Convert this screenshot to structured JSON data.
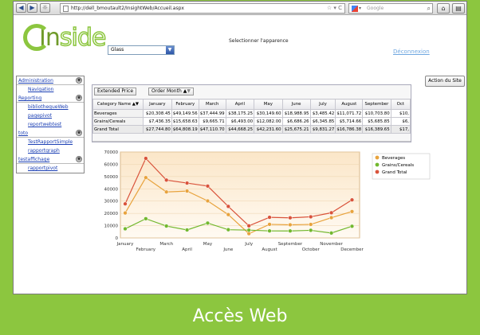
{
  "browser": {
    "url": "http://dell_bmoutault2/InsightWeb/Accueil.aspx",
    "search_placeholder": "Google"
  },
  "header": {
    "logo_in": "In",
    "logo_side": "side",
    "theme_value": "Glass",
    "theme_label": "Selectionner l'apparence",
    "logout": "Déconnexion"
  },
  "sidebar": {
    "groups": [
      {
        "label": "Administration",
        "items": [
          "Navigation"
        ]
      },
      {
        "label": "Reporting",
        "items": [
          "bibliothequeWeb",
          "pagepivot",
          "reportwebtest"
        ]
      },
      {
        "label": "toto",
        "items": [
          "TestRapportSimple",
          "rapportgraph"
        ]
      },
      {
        "label": "testaffichage",
        "items": [
          "rapportpivot"
        ]
      }
    ]
  },
  "action_button": "Action du Site",
  "pivot": {
    "data_field": "Extended Price",
    "column_field": "Order Month",
    "row_field": "Category Name",
    "months": [
      "January",
      "February",
      "March",
      "April",
      "May",
      "June",
      "July",
      "August",
      "September",
      "Oct"
    ],
    "rows": [
      {
        "name": "Beverages",
        "cells": [
          "$20,308.45",
          "$49,149.56",
          "$37,444.99",
          "$38,175.25",
          "$30,149.60",
          "$18,988.95",
          "$3,485.42",
          "$11,071.72",
          "$10,703.80",
          "$10,"
        ]
      },
      {
        "name": "Grains/Cereals",
        "cells": [
          "$7,436.35",
          "$15,658.63",
          "$9,665.71",
          "$6,493.00",
          "$12,082.00",
          "$6,686.26",
          "$6,345.85",
          "$5,714.66",
          "$5,685.85",
          "$6,"
        ]
      },
      {
        "name": "Grand Total",
        "cells": [
          "$27,744.80",
          "$64,808.19",
          "$47,110.70",
          "$44,668.25",
          "$42,231.60",
          "$25,675.21",
          "$9,831.27",
          "$16,786.38",
          "$16,389.65",
          "$17,"
        ]
      }
    ]
  },
  "chart_data": {
    "type": "line",
    "categories": [
      "January",
      "February",
      "March",
      "April",
      "May",
      "June",
      "July",
      "August",
      "September",
      "October",
      "November",
      "December"
    ],
    "series": [
      {
        "name": "Beverages",
        "color": "#e8a33d",
        "values": [
          20308,
          49150,
          37445,
          38175,
          30150,
          18989,
          3485,
          11072,
          10704,
          11000,
          16500,
          21500
        ]
      },
      {
        "name": "Grains/Cereals",
        "color": "#72b82e",
        "values": [
          7436,
          15659,
          9666,
          6493,
          12082,
          6686,
          6346,
          5715,
          5686,
          6200,
          4000,
          9500
        ]
      },
      {
        "name": "Grand Total",
        "color": "#d9533b",
        "values": [
          27745,
          64808,
          47111,
          44668,
          42232,
          25675,
          9831,
          16786,
          16390,
          17200,
          20500,
          31000
        ]
      }
    ],
    "yticks": [
      "0",
      "10000",
      "20000",
      "30000",
      "40000",
      "50000",
      "60000",
      "70000"
    ],
    "ylim": [
      0,
      70000
    ],
    "legend": "top-right",
    "grid": true
  },
  "footer": "Accès Web"
}
